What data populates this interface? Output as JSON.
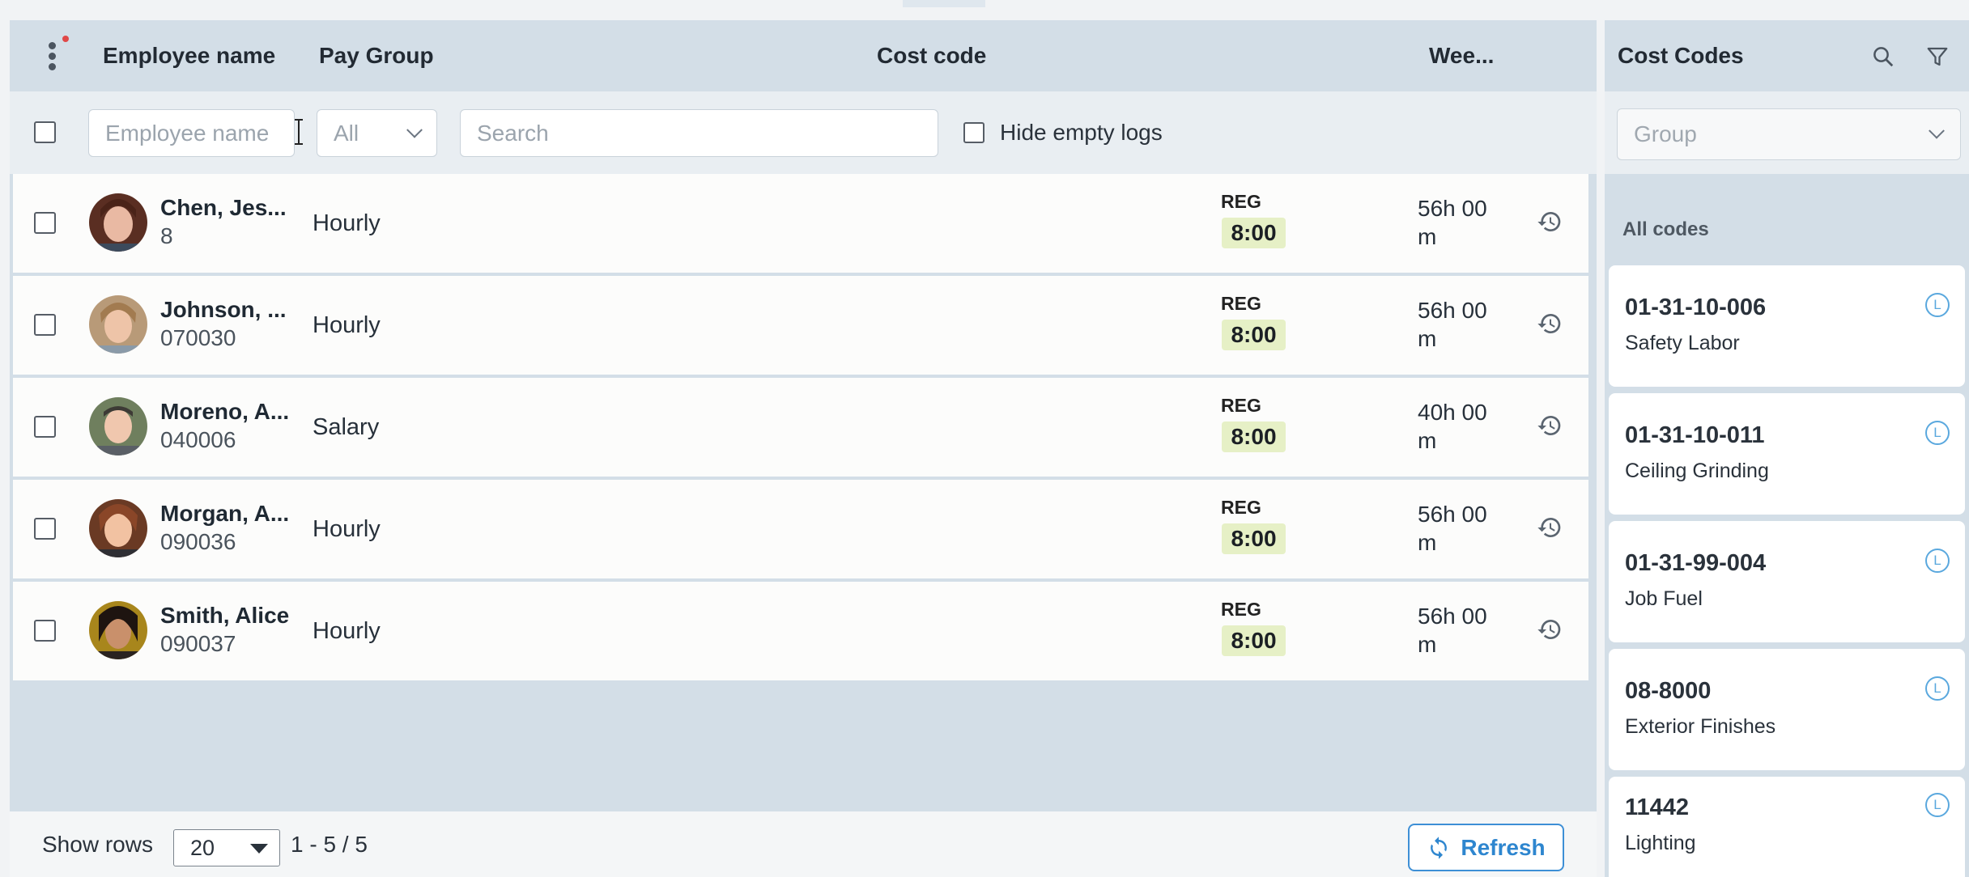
{
  "table": {
    "columns": {
      "employee": "Employee name",
      "paygroup": "Pay Group",
      "costcode": "Cost code",
      "week": "Wee..."
    },
    "filters": {
      "employee_placeholder": "Employee name",
      "paygroup_value": "All",
      "search_placeholder": "Search",
      "hide_empty_label": "Hide empty logs"
    },
    "rows": [
      {
        "name": "Chen, Jes...",
        "id": "8",
        "paygroup": "Hourly",
        "code": "REG",
        "hours": "8:00",
        "week_line1": "56h 00",
        "week_line2": "m"
      },
      {
        "name": "Johnson, ...",
        "id": "070030",
        "paygroup": "Hourly",
        "code": "REG",
        "hours": "8:00",
        "week_line1": "56h 00",
        "week_line2": "m"
      },
      {
        "name": "Moreno, A...",
        "id": "040006",
        "paygroup": "Salary",
        "code": "REG",
        "hours": "8:00",
        "week_line1": "40h 00",
        "week_line2": "m"
      },
      {
        "name": "Morgan, A...",
        "id": "090036",
        "paygroup": "Hourly",
        "code": "REG",
        "hours": "8:00",
        "week_line1": "56h 00",
        "week_line2": "m"
      },
      {
        "name": "Smith, Alice",
        "id": "090037",
        "paygroup": "Hourly",
        "code": "REG",
        "hours": "8:00",
        "week_line1": "56h 00",
        "week_line2": "m"
      }
    ]
  },
  "footer": {
    "show_rows_label": "Show rows",
    "rows_value": "20",
    "pager": "1 - 5 / 5",
    "refresh_label": "Refresh"
  },
  "side": {
    "title": "Cost Codes",
    "group_placeholder": "Group",
    "all_codes": "All codes",
    "cards": [
      {
        "code": "01-31-10-006",
        "desc": "Safety Labor",
        "badge": "L"
      },
      {
        "code": "01-31-10-011",
        "desc": "Ceiling Grinding",
        "badge": "L"
      },
      {
        "code": "01-31-99-004",
        "desc": "Job Fuel",
        "badge": "L"
      },
      {
        "code": "08-8000",
        "desc": "Exterior Finishes",
        "badge": "L"
      },
      {
        "code": "11442",
        "desc": "Lighting",
        "badge": "L"
      }
    ]
  },
  "colors": {
    "accent": "#2e86cf",
    "hours_badge_bg": "#e6f0c6",
    "panel_bg": "#d3dee7"
  },
  "icons": [
    "more-vert-icon",
    "history-icon",
    "search-icon",
    "filter-icon",
    "refresh-icon",
    "chevron-down-icon"
  ]
}
